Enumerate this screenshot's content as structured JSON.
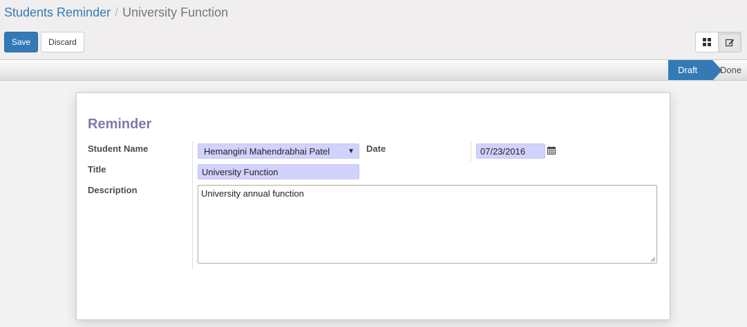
{
  "breadcrumb": {
    "parent": "Students Reminder",
    "separator": "/",
    "current": "University Function"
  },
  "toolbar": {
    "save_label": "Save",
    "discard_label": "Discard",
    "view_icons": [
      "kanban-grid-icon",
      "edit-form-icon"
    ]
  },
  "statusbar": {
    "stages": [
      "Draft",
      "Done"
    ],
    "active_stage": "Draft"
  },
  "form": {
    "title": "Reminder",
    "student_name_label": "Student Name",
    "student_name_value": "Hemangini Mahendrabhai Patel",
    "date_label": "Date",
    "date_value": "07/23/2016",
    "title_label": "Title",
    "title_value": "University Function",
    "description_label": "Description",
    "description_value": "University annual function"
  },
  "colors": {
    "primary": "#337ab7",
    "sheet_title": "#7c7bad",
    "required_field": "#d2d2ff"
  }
}
